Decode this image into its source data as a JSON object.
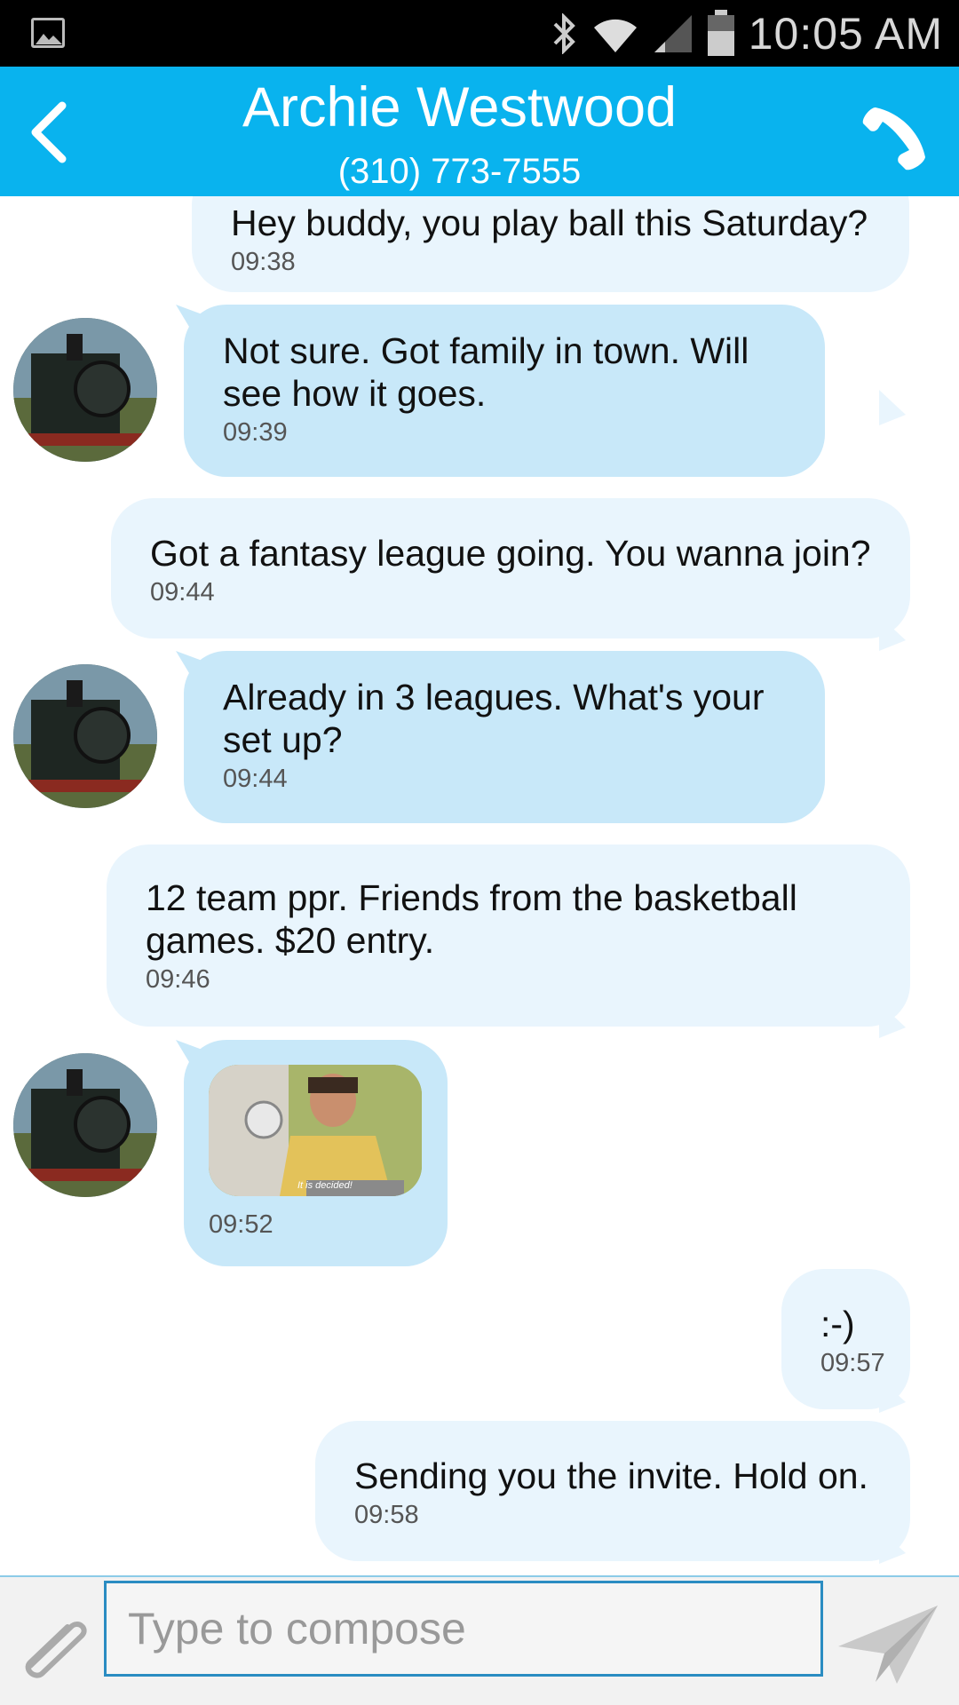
{
  "status_bar": {
    "time": "10:05 AM",
    "icons": [
      "image-icon",
      "bluetooth-icon",
      "wifi-icon",
      "signal-icon",
      "battery-icon"
    ]
  },
  "header": {
    "contact_name": "Archie Westwood",
    "contact_phone": "(310) 773-7555",
    "back_icon": "chevron-left-icon",
    "call_icon": "phone-icon",
    "background_color": "#09b3ee"
  },
  "messages": [
    {
      "direction": "outgoing",
      "text": "Hey buddy, you play ball this Saturday?",
      "time": "09:38"
    },
    {
      "direction": "incoming",
      "text": "Not sure. Got family in town. Will see how it goes.",
      "time": "09:39"
    },
    {
      "direction": "outgoing",
      "text": "Got a fantasy league going. You wanna join?",
      "time": "09:44"
    },
    {
      "direction": "incoming",
      "text": "Already in 3 leagues. What's your set up?",
      "time": "09:44"
    },
    {
      "direction": "outgoing",
      "text": "12 team ppr. Friends from the basketball games. $20 entry.",
      "time": "09:46"
    },
    {
      "direction": "incoming",
      "type": "image",
      "image_caption": "It is decided!",
      "time": "09:52"
    },
    {
      "direction": "outgoing",
      "text": ":-)",
      "time": "09:57"
    },
    {
      "direction": "outgoing",
      "text": "Sending you the invite. Hold on.",
      "time": "09:58"
    }
  ],
  "compose": {
    "placeholder": "Type to compose",
    "attach_icon": "paperclip-icon",
    "send_icon": "send-icon"
  },
  "colors": {
    "outgoing_bubble": "#e9f5fd",
    "incoming_bubble": "#c8e8f9",
    "input_border": "#2a8cc2"
  }
}
